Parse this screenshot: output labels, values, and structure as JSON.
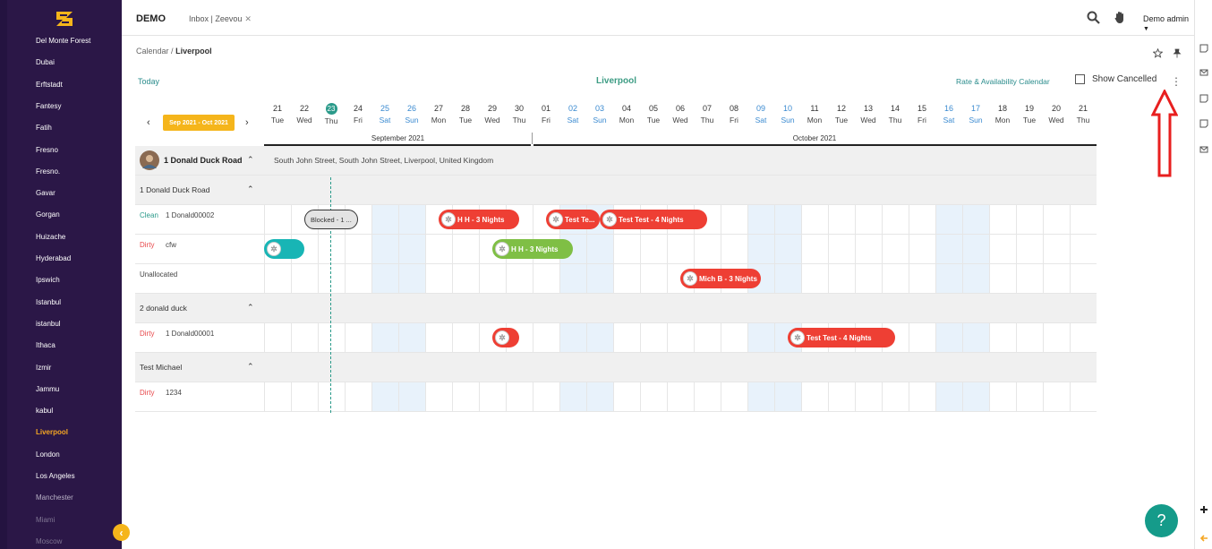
{
  "sidebar": {
    "cities": [
      {
        "label": "Del Monte Forest",
        "state": "normal"
      },
      {
        "label": "Dubai",
        "state": "normal"
      },
      {
        "label": "Erftstadt",
        "state": "normal"
      },
      {
        "label": "Fantesy",
        "state": "normal"
      },
      {
        "label": "Fatih",
        "state": "normal"
      },
      {
        "label": "Fresno",
        "state": "normal"
      },
      {
        "label": "Fresno.",
        "state": "normal"
      },
      {
        "label": "Gavar",
        "state": "normal"
      },
      {
        "label": "Gorgan",
        "state": "normal"
      },
      {
        "label": "Huizache",
        "state": "normal"
      },
      {
        "label": "Hyderabad",
        "state": "normal"
      },
      {
        "label": "Ipswich",
        "state": "normal"
      },
      {
        "label": "Istanbul",
        "state": "normal"
      },
      {
        "label": "istanbul",
        "state": "normal"
      },
      {
        "label": "Ithaca",
        "state": "normal"
      },
      {
        "label": "Izmir",
        "state": "normal"
      },
      {
        "label": "Jammu",
        "state": "normal"
      },
      {
        "label": "kabul",
        "state": "normal"
      },
      {
        "label": "Liverpool",
        "state": "active"
      },
      {
        "label": "London",
        "state": "normal"
      },
      {
        "label": "Los Angeles",
        "state": "normal"
      },
      {
        "label": "Manchester",
        "state": "dim"
      },
      {
        "label": "Miami",
        "state": "dimmer"
      },
      {
        "label": "Moscow",
        "state": "dimmer"
      }
    ],
    "collapse_icon": "chevron-left-icon"
  },
  "topbar": {
    "brand": "DEMO",
    "tab_label": "Inbox | Zeevou",
    "tab_close": "✕",
    "user_label": "Demo admin",
    "icons": [
      "search-icon",
      "hand-icon",
      "caret-down-icon"
    ]
  },
  "breadcrumb": {
    "root": "Calendar",
    "separator": "/",
    "current": "Liverpool"
  },
  "toolbar": {
    "today": "Today",
    "title": "Liverpool",
    "rate_link": "Rate & Availability Calendar",
    "show_cancelled": "Show Cancelled",
    "show_cancelled_checked": false,
    "kebab": "⋮",
    "range_label": "Sep 2021 - Oct 2021",
    "prev": "‹",
    "next": "›"
  },
  "days": [
    {
      "n": "21",
      "w": "Tue",
      "we": false
    },
    {
      "n": "22",
      "w": "Wed",
      "we": false
    },
    {
      "n": "23",
      "w": "Thu",
      "we": false,
      "today": true
    },
    {
      "n": "24",
      "w": "Fri",
      "we": false
    },
    {
      "n": "25",
      "w": "Sat",
      "we": true
    },
    {
      "n": "26",
      "w": "Sun",
      "we": true
    },
    {
      "n": "27",
      "w": "Mon",
      "we": false
    },
    {
      "n": "28",
      "w": "Tue",
      "we": false
    },
    {
      "n": "29",
      "w": "Wed",
      "we": false
    },
    {
      "n": "30",
      "w": "Thu",
      "we": false
    },
    {
      "n": "01",
      "w": "Fri",
      "we": false
    },
    {
      "n": "02",
      "w": "Sat",
      "we": true
    },
    {
      "n": "03",
      "w": "Sun",
      "we": true
    },
    {
      "n": "04",
      "w": "Mon",
      "we": false
    },
    {
      "n": "05",
      "w": "Tue",
      "we": false
    },
    {
      "n": "06",
      "w": "Wed",
      "we": false
    },
    {
      "n": "07",
      "w": "Thu",
      "we": false
    },
    {
      "n": "08",
      "w": "Fri",
      "we": false
    },
    {
      "n": "09",
      "w": "Sat",
      "we": true
    },
    {
      "n": "10",
      "w": "Sun",
      "we": true
    },
    {
      "n": "11",
      "w": "Mon",
      "we": false
    },
    {
      "n": "12",
      "w": "Tue",
      "we": false
    },
    {
      "n": "13",
      "w": "Wed",
      "we": false
    },
    {
      "n": "14",
      "w": "Thu",
      "we": false
    },
    {
      "n": "15",
      "w": "Fri",
      "we": false
    },
    {
      "n": "16",
      "w": "Sat",
      "we": true
    },
    {
      "n": "17",
      "w": "Sun",
      "we": true
    },
    {
      "n": "18",
      "w": "Mon",
      "we": false
    },
    {
      "n": "19",
      "w": "Tue",
      "we": false
    },
    {
      "n": "20",
      "w": "Wed",
      "we": false
    },
    {
      "n": "21",
      "w": "Thu",
      "we": false
    }
  ],
  "months": [
    "September 2021",
    "October 2021"
  ],
  "property": {
    "name": "1 Donald Duck Road",
    "address": "South John Street, South John Street, Liverpool, United Kingdom"
  },
  "groups": [
    {
      "name": "1 Donald Duck Road",
      "units": [
        {
          "status": "Clean",
          "status_type": "clean",
          "unit": "1 Donald00002"
        },
        {
          "status": "Dirty",
          "status_type": "dirty",
          "unit": "cfw"
        },
        {
          "status": "",
          "status_type": "",
          "unit": "Unallocated"
        }
      ]
    },
    {
      "name": "2 donald duck",
      "units": [
        {
          "status": "Dirty",
          "status_type": "dirty",
          "unit": "1 Donald00001"
        }
      ]
    },
    {
      "name": "Test Michael",
      "units": [
        {
          "status": "Dirty",
          "status_type": "dirty",
          "unit": "1234"
        }
      ]
    }
  ],
  "bookings": [
    {
      "label": "Blocked - 1 ...",
      "color": "blocked",
      "row": 0,
      "start": 1.5,
      "len": 2
    },
    {
      "label": "H H - 3 Nights",
      "color": "red",
      "row": 0,
      "start": 6.5,
      "len": 3
    },
    {
      "label": "Test Te...",
      "color": "red",
      "row": 0,
      "start": 10.5,
      "len": 2
    },
    {
      "label": "Test Test - 4 Nights",
      "color": "red",
      "row": 0,
      "start": 12.5,
      "len": 4
    },
    {
      "label": "",
      "color": "teal",
      "row": 1,
      "start": 0,
      "len": 1.5
    },
    {
      "label": "H H - 3 Nights",
      "color": "green",
      "row": 1,
      "start": 8.5,
      "len": 3
    },
    {
      "label": "Mich B - 3 Nights",
      "color": "red",
      "row": 2,
      "start": 15.5,
      "len": 3
    },
    {
      "label": "",
      "color": "red",
      "row": 3,
      "start": 8.5,
      "len": 1
    },
    {
      "label": "Test Test - 4 Nights",
      "color": "red",
      "row": 3,
      "start": 19.5,
      "len": 4
    }
  ],
  "help_icon": "question-icon",
  "annotation_arrow": "up-arrow-outline"
}
